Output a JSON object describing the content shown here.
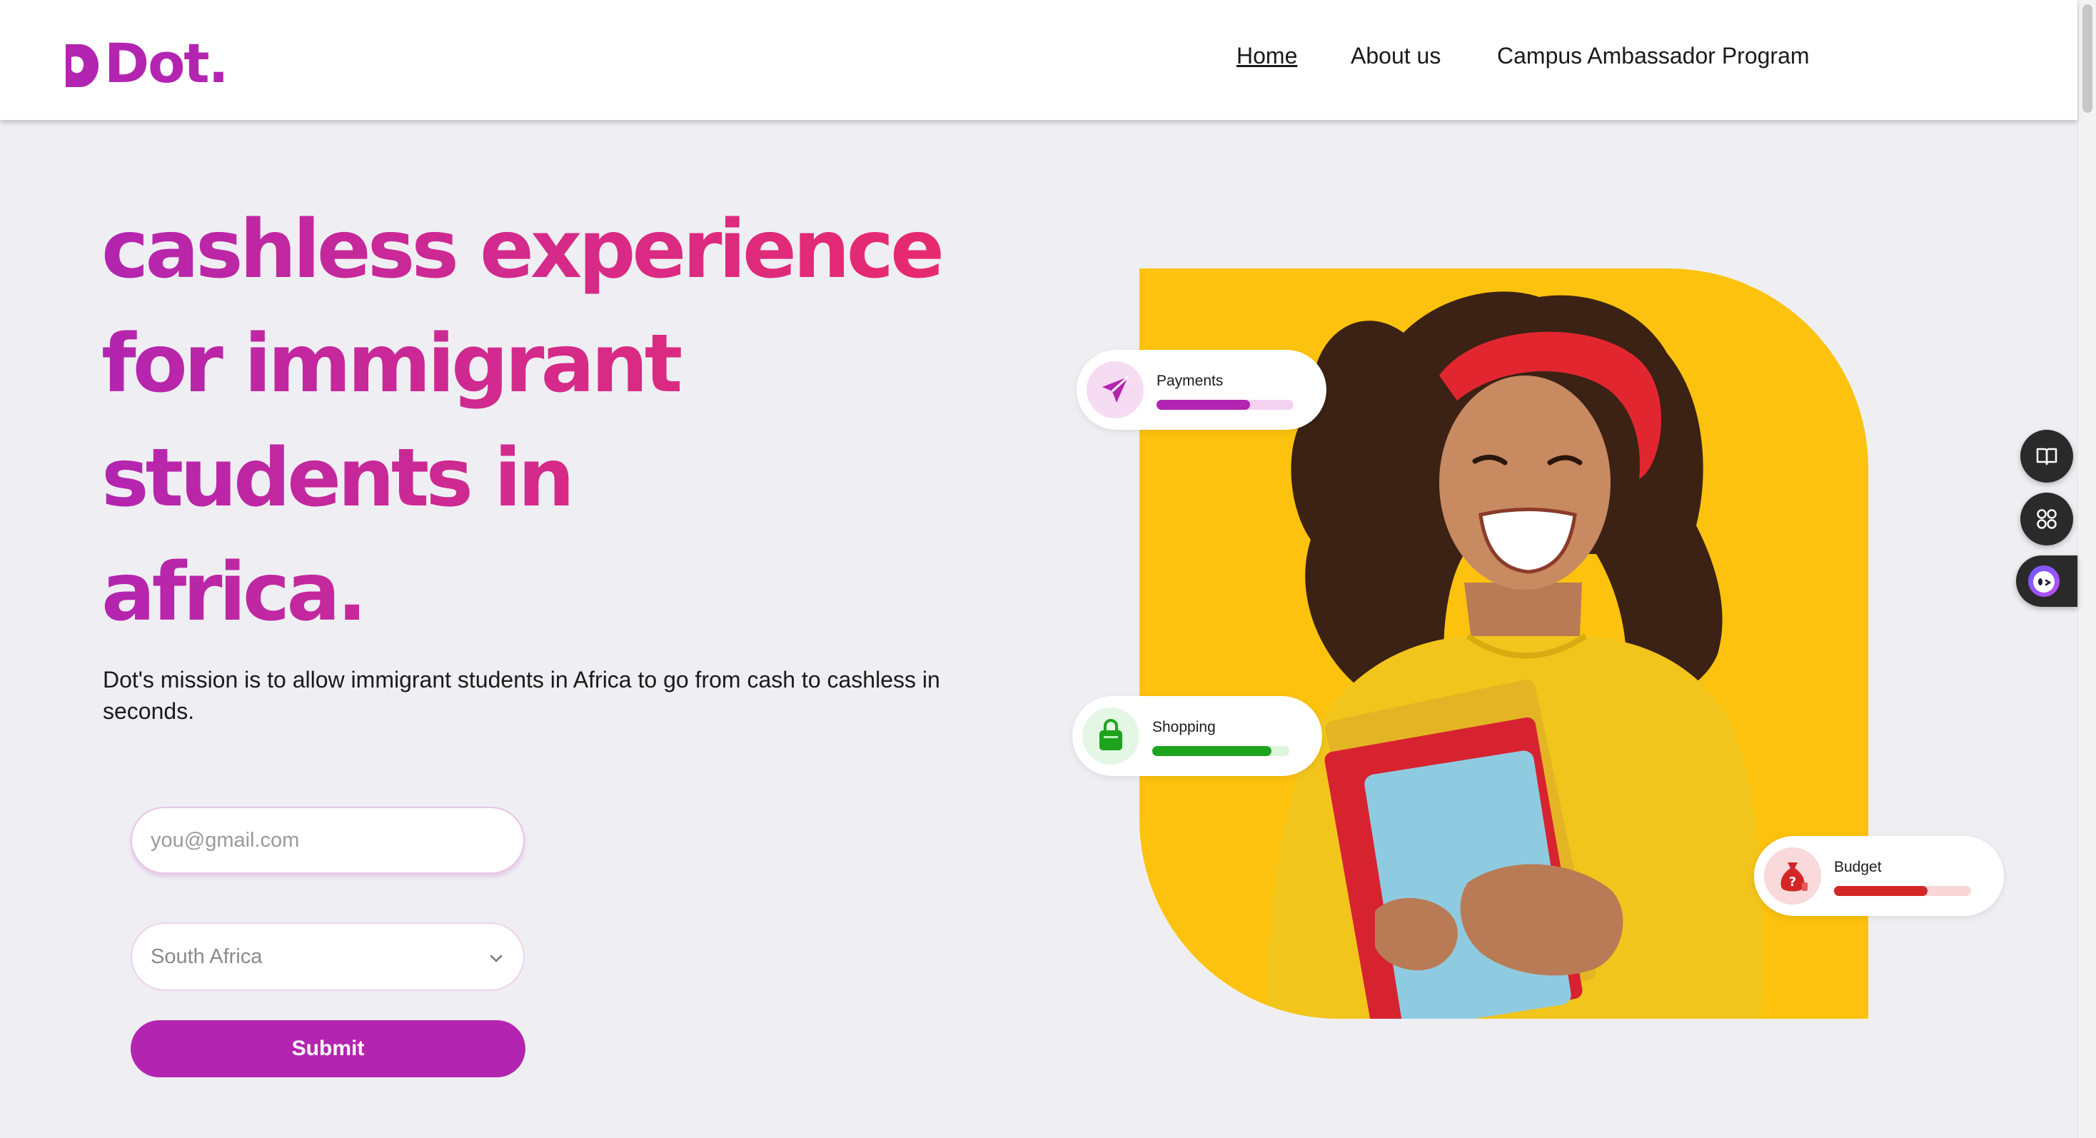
{
  "brand": {
    "name": "Dot.",
    "color": "#b325b0"
  },
  "nav": {
    "items": [
      {
        "label": "Home",
        "active": true
      },
      {
        "label": "About us",
        "active": false
      },
      {
        "label": "Campus Ambassador Program",
        "active": false
      }
    ]
  },
  "hero": {
    "headline_lines": [
      "cashless experience",
      "for immigrant",
      "students in",
      "africa."
    ],
    "mission": "Dot's mission is to allow immigrant students in Africa to go from cash to cashless in seconds."
  },
  "form": {
    "email_placeholder": "you@gmail.com",
    "country_selected": "South Africa",
    "submit_label": "Submit"
  },
  "cards": [
    {
      "label": "Payments",
      "icon": "paper-plane-icon",
      "progress_percent": 68,
      "color": "#b325b0",
      "track_color": "#f3d2f0"
    },
    {
      "label": "Shopping",
      "icon": "shopping-bag-icon",
      "progress_percent": 87,
      "color": "#1ea31e",
      "track_color": "#dcf5dc"
    },
    {
      "label": "Budget",
      "icon": "money-bag-icon",
      "progress_percent": 68,
      "color": "#d42626",
      "track_color": "#f8d6d6"
    }
  ],
  "dock": {
    "icons": [
      "book-icon",
      "apps-icon",
      "assistant-icon"
    ]
  },
  "colors": {
    "background": "#efeff3",
    "hero_yellow": "#fcc20d",
    "gradient_start": "#b325b0",
    "gradient_end": "#ee2a64"
  }
}
